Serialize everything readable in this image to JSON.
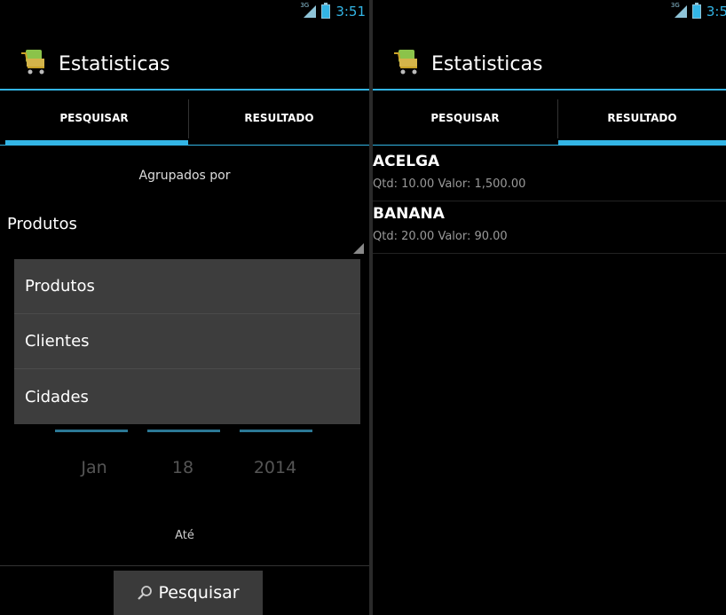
{
  "left": {
    "status": {
      "time": "3:51",
      "network": "3G"
    },
    "app": {
      "title": "Estatisticas",
      "icon": "shopping-cart-icon"
    },
    "tabs": [
      {
        "label": "PESQUISAR",
        "selected": true
      },
      {
        "label": "RESULTADO",
        "selected": false
      }
    ],
    "group_label": "Agrupados por",
    "spinner_value": "Produtos",
    "dropdown_options": [
      "Produtos",
      "Clientes",
      "Cidades"
    ],
    "date": {
      "month": "Jan",
      "day": "18",
      "year": "2014"
    },
    "until_label": "Até",
    "search_button": "Pesquisar"
  },
  "right": {
    "status": {
      "time": "3:5",
      "network": "3G"
    },
    "app": {
      "title": "Estatisticas",
      "icon": "shopping-cart-icon"
    },
    "tabs": [
      {
        "label": "PESQUISAR",
        "selected": false
      },
      {
        "label": "RESULTADO",
        "selected": true
      }
    ],
    "results": [
      {
        "name": "ACELGA",
        "detail": "Qtd: 10.00  Valor: 1,500.00"
      },
      {
        "name": "BANANA",
        "detail": "Qtd: 20.00  Valor: 90.00"
      }
    ]
  },
  "colors": {
    "accent": "#33b5e5",
    "background": "#000000",
    "dropdown": "#3d3d3d"
  }
}
